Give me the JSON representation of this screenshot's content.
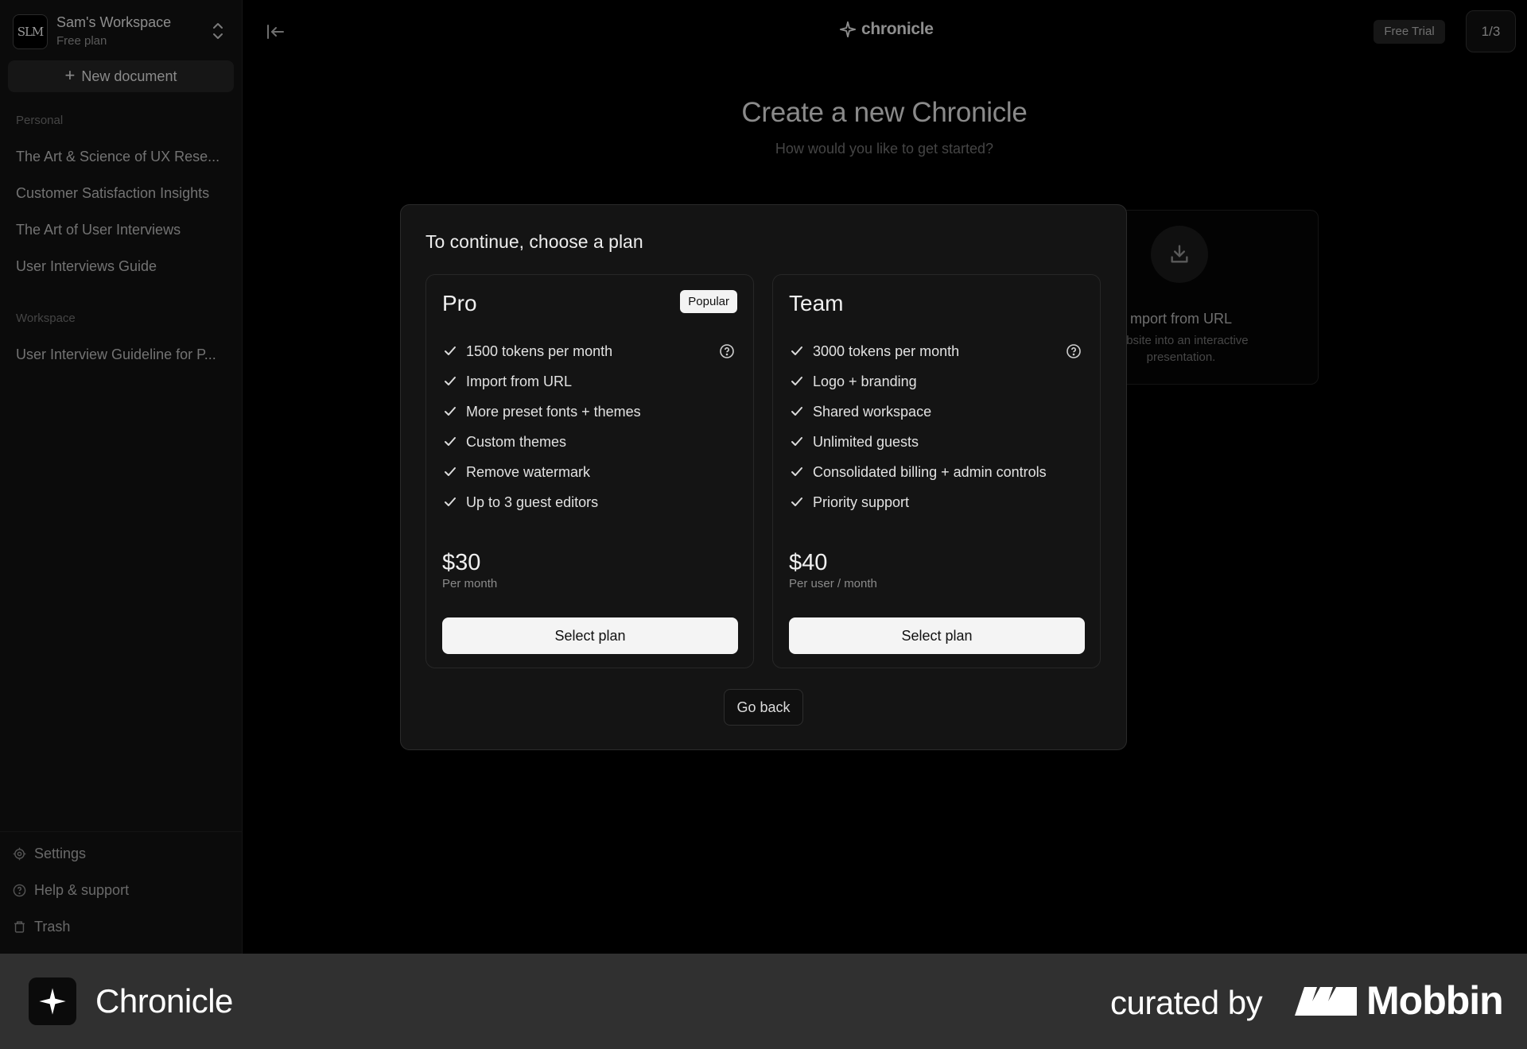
{
  "sidebar": {
    "workspace": {
      "avatar": "SLM",
      "name": "Sam's Workspace",
      "plan": "Free plan"
    },
    "new_document_label": "New document",
    "personal_label": "Personal",
    "personal_items": [
      "The Art & Science of UX Rese...",
      "Customer Satisfaction Insights",
      "The Art of User Interviews",
      "User Interviews Guide"
    ],
    "workspace_label": "Workspace",
    "workspace_items": [
      "User Interview Guideline for P..."
    ],
    "footer": {
      "settings": "Settings",
      "help": "Help & support",
      "trash": "Trash"
    }
  },
  "topbar": {
    "brand": "chronicle",
    "trial": "Free Trial",
    "page_counter": "1/3"
  },
  "hero": {
    "title": "Create a new Chronicle",
    "subtitle": "How would you like to get started?"
  },
  "import_card": {
    "title": "mport from URL",
    "desc_line1": "vebsite into an interactive",
    "desc_line2": "presentation."
  },
  "modal": {
    "title": "To continue, choose a plan",
    "plans": [
      {
        "name": "Pro",
        "badge": "Popular",
        "features": [
          "1500 tokens per month",
          "Import from URL",
          "More preset fonts + themes",
          "Custom themes",
          "Remove watermark",
          "Up to 3 guest editors"
        ],
        "price": "$30",
        "price_unit": "Per month",
        "cta": "Select plan"
      },
      {
        "name": "Team",
        "features": [
          "3000 tokens per month",
          "Logo + branding",
          "Shared workspace",
          "Unlimited guests",
          "Consolidated billing + admin controls",
          "Priority support"
        ],
        "price": "$40",
        "price_unit": "Per user / month",
        "cta": "Select plan"
      }
    ],
    "go_back": "Go back"
  },
  "banner": {
    "app_name": "Chronicle",
    "curated_by": "curated by",
    "brand": "Mobbin"
  }
}
